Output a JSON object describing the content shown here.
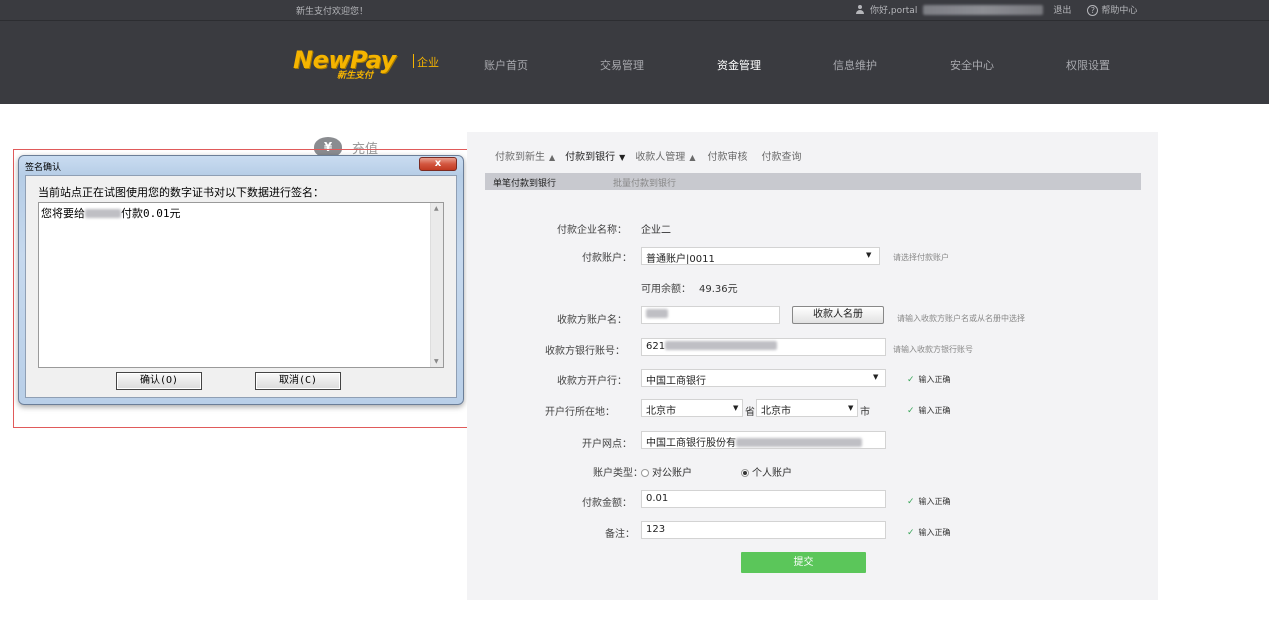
{
  "header": {
    "welcome": "新生支付欢迎您！",
    "greeting": "你好,portal",
    "logout": "退出",
    "help": "帮助中心",
    "help_glyph": "?",
    "logo_text": "NewPay",
    "logo_sub": "新生支付",
    "logo_suffix": "企业",
    "nav": [
      {
        "label": "账户首页",
        "active": false
      },
      {
        "label": "交易管理",
        "active": false
      },
      {
        "label": "资金管理",
        "active": true
      },
      {
        "label": "信息维护",
        "active": false
      },
      {
        "label": "安全中心",
        "active": false
      },
      {
        "label": "权限设置",
        "active": false
      }
    ]
  },
  "recharge": {
    "icon": "yen-icon",
    "glyph": "¥",
    "label": "充值"
  },
  "dialog": {
    "title": "签名确认",
    "close_glyph": "x",
    "message": "当前站点正在试图使用您的数字证书对以下数据进行签名：",
    "content_prefix": "您将要给",
    "content_suffix": "付款0.01元",
    "confirm": "确认(O)",
    "cancel": "取消(C)"
  },
  "payment": {
    "tabs": [
      {
        "label": "付款到新生",
        "caret": "▲",
        "active": false
      },
      {
        "label": "付款到银行",
        "caret": "▼",
        "active": true
      },
      {
        "label": "收款人管理",
        "caret": "▲",
        "active": false
      },
      {
        "label": "付款审核",
        "caret": "",
        "active": false
      },
      {
        "label": "付款查询",
        "caret": "",
        "active": false
      }
    ],
    "subtabs": [
      "单笔付款到银行",
      "批量付款到银行"
    ],
    "company_label": "付款企业名称：",
    "company_value": "企业二",
    "account_label": "付款账户：",
    "account_value": "普通账户|0011",
    "account_hint": "请选择付款账户",
    "balance_label": "可用余额：",
    "balance_value": "49.36元",
    "payee_label": "收款方账户名：",
    "payee_button": "收款人名册",
    "payee_hint": "请输入收款方账户名或从名册中选择",
    "bank_account_label": "收款方银行账号：",
    "bank_account_value": "621",
    "bank_account_hint": "请输入收款方银行账号",
    "bank_label": "收款方开户行：",
    "bank_value": "中国工商银行",
    "location_label": "开户行所在地：",
    "province_value": "北京市",
    "province_suffix": "省",
    "city_value": "北京市",
    "city_suffix": "市",
    "branch_label": "开户网点：",
    "branch_value": "中国工商银行股份有",
    "account_type_label": "账户类型：",
    "account_type_public": "对公账户",
    "account_type_personal": "个人账户",
    "amount_label": "付款金额：",
    "amount_value": "0.01",
    "remark_label": "备注：",
    "remark_value": "123",
    "valid_text": "输入正确",
    "submit": "提交"
  }
}
